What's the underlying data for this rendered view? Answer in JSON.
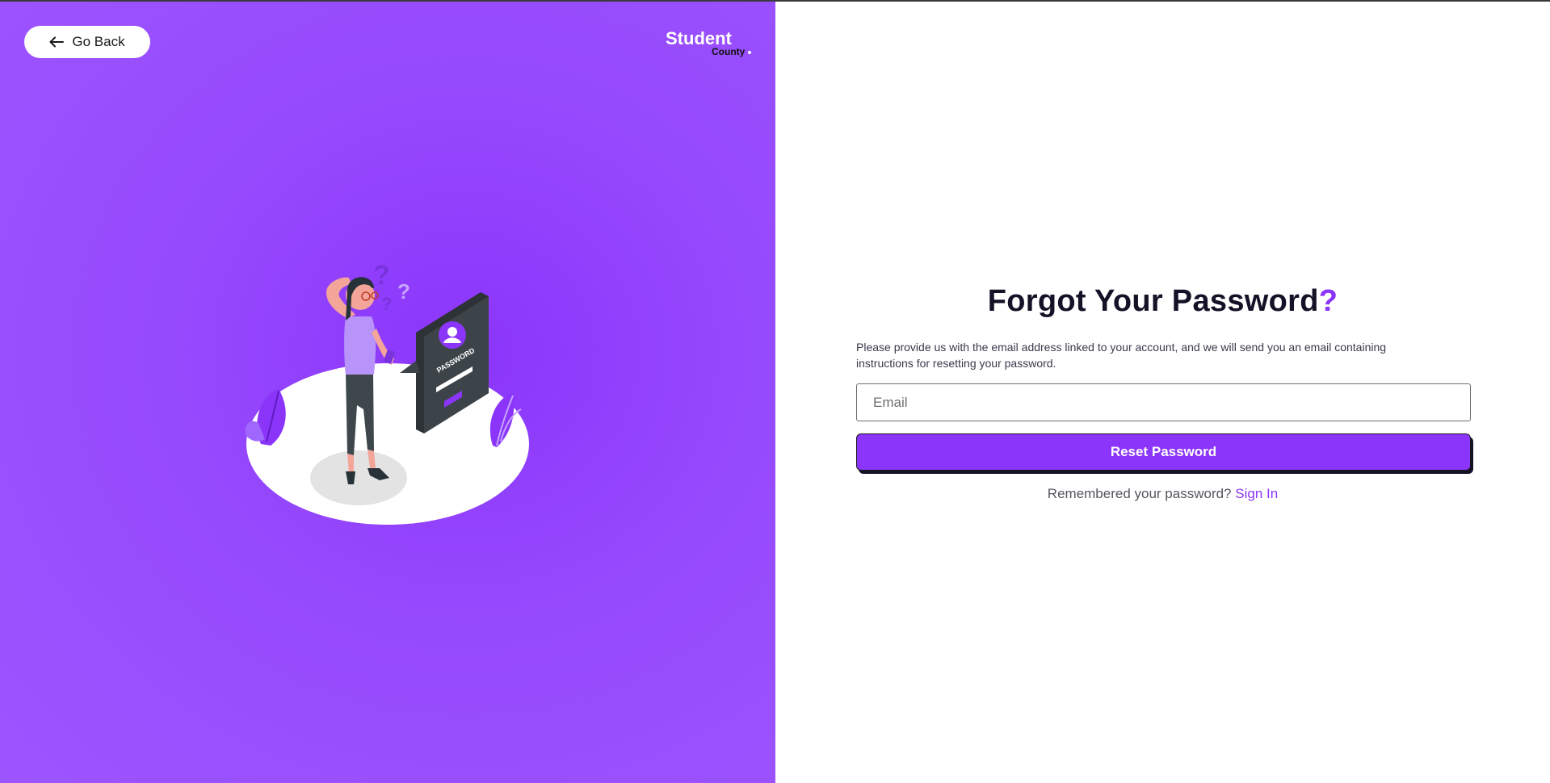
{
  "left_panel": {
    "go_back": {
      "label": "Go Back",
      "icon": "arrow-left-icon"
    },
    "logo": {
      "main": "Student",
      "sub": "County",
      "dot": "."
    },
    "illustration": {
      "subject": "forgot-password-illustration",
      "card_label": "PASSWORD",
      "question_marks": [
        "?",
        "?",
        "?"
      ]
    },
    "colors": {
      "background": "#964afd",
      "accent": "#8b35fb"
    }
  },
  "form": {
    "title": "Forgot Your Password",
    "title_mark": "?",
    "description": "Please provide us with the email address linked to your account, and we will send you an email containing instructions for resetting your password.",
    "email_placeholder": "Email",
    "email_value": "",
    "submit_label": "Reset Password",
    "remember_text": "Remembered your password?",
    "signin_label": "Sign In"
  },
  "colors": {
    "primary": "#8b35fb",
    "title": "#151126",
    "button_shadow": "#151126"
  }
}
